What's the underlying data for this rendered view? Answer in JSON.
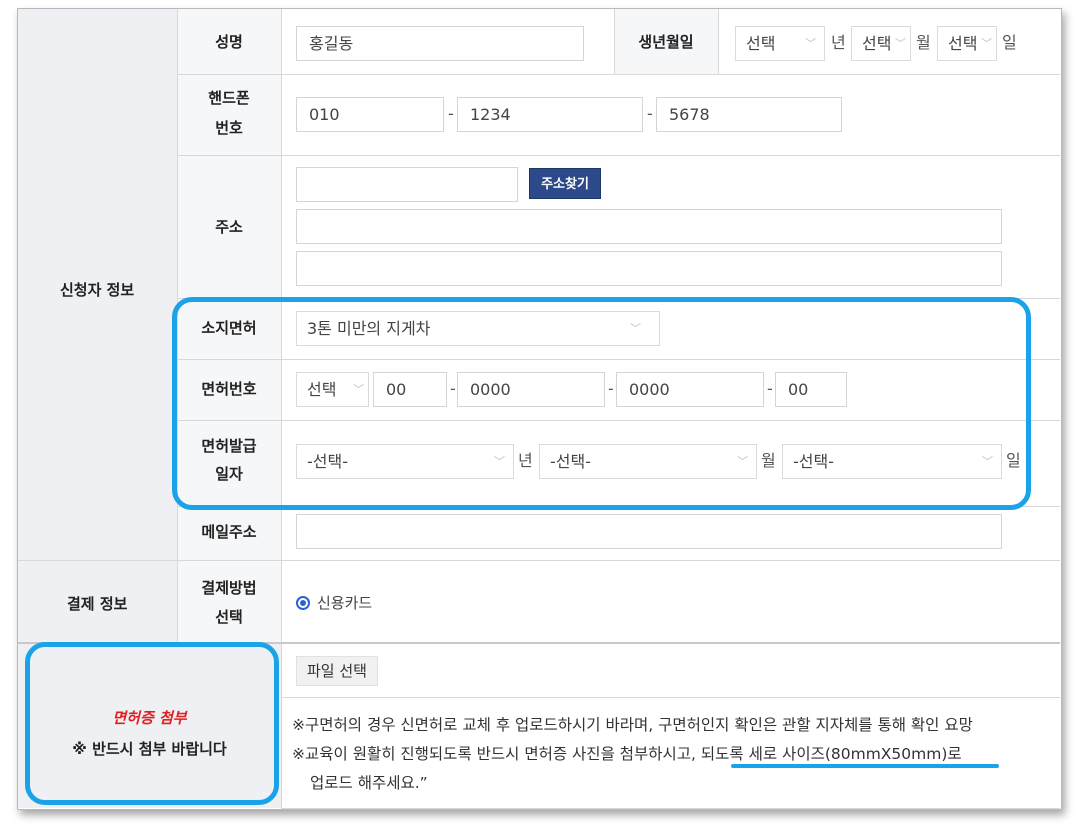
{
  "applicant": {
    "section_label": "신청자 정보",
    "name": {
      "label": "성명",
      "value": "홍길동"
    },
    "birth": {
      "label": "생년월일",
      "year_select": "선택",
      "year_unit": "년",
      "month_select": "선택",
      "month_unit": "월",
      "day_select": "선택",
      "day_unit": "일"
    },
    "phone": {
      "label_line1": "핸드폰",
      "label_line2": "번호",
      "part1": "010",
      "part2": "1234",
      "part3": "5678",
      "sep": "-"
    },
    "address": {
      "label": "주소",
      "search_button": "주소찾기",
      "zip": "",
      "line1": "",
      "line2": ""
    },
    "license_type": {
      "label": "소지면허",
      "value": "3톤 미만의 지게차"
    },
    "license_no": {
      "label": "면허번호",
      "region_select": "선택",
      "part1": "00",
      "part2": "0000",
      "part3": "0000",
      "part4": "00",
      "sep": "-"
    },
    "license_issue": {
      "label_line1": "면허발급",
      "label_line2": "일자",
      "year_select": "-선택-",
      "year_unit": "년",
      "month_select": "-선택-",
      "month_unit": "월",
      "day_select": "-선택-",
      "day_unit": "일"
    },
    "email": {
      "label": "메일주소",
      "value": ""
    }
  },
  "payment": {
    "section_label": "결제 정보",
    "method_label_line1": "결제방법",
    "method_label_line2": "선택",
    "option": "신용카드"
  },
  "attachment": {
    "title": "면허증 첨부",
    "subtitle": "※ 반드시 첨부 바랍니다",
    "file_button": "파일 선택",
    "note1": "※구면허의 경우 신면허로 교체 후 업로드하시기 바라며, 구면허인지 확인은 관할 지자체를 통해 확인 요망",
    "note2_prefix": "※교육이 원활히 진행되도록 반드시 면허증 사진을 첨부하시고, ",
    "note2_highlight": "되도록 세로 사이즈(80mmX50mm)로",
    "note3": "업로드 해주세요.”"
  },
  "colors": {
    "accent": "#1aa3e8",
    "button": "#2c4a8a",
    "title_red": "#e02020"
  }
}
